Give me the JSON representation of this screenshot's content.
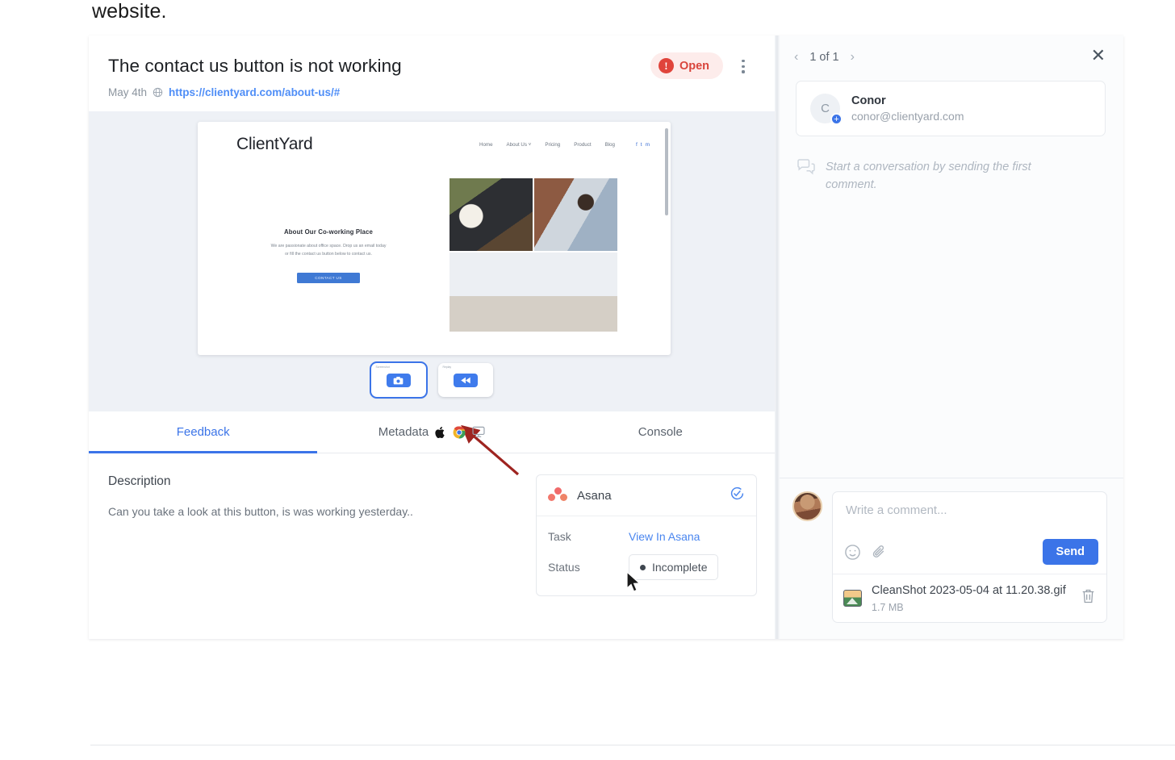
{
  "stray_text": "website.",
  "header": {
    "title": "The contact us button is not working",
    "status_label": "Open",
    "status_color": "#d9453c",
    "date": "May 4th",
    "url": "https://clientyard.com/about-us/#",
    "menu_icon": "kebab-menu-icon"
  },
  "preview": {
    "site": {
      "logo": "ClientYard",
      "nav": [
        "Home",
        "About Us ˅",
        "Pricing",
        "Product",
        "Blog"
      ],
      "social": [
        "f",
        "t",
        "m"
      ],
      "heading": "About Our Co-working Place",
      "paragraph_1": "We are passionate about office space. Drop us an email today",
      "paragraph_2": "or fill the contact us button below to contact us.",
      "button_label": "CONTACT US"
    },
    "thumbnails": [
      {
        "caption": "Screenshot",
        "icon": "camera-icon",
        "selected": true
      },
      {
        "caption": "Replay",
        "icon": "rewind-icon",
        "selected": false
      }
    ]
  },
  "tabs": [
    {
      "label": "Feedback",
      "active": true
    },
    {
      "label": "Metadata",
      "active": false,
      "icons": [
        "apple-icon",
        "chrome-icon",
        "desktop-icon"
      ]
    },
    {
      "label": "Console",
      "active": false
    }
  ],
  "feedback": {
    "description_heading": "Description",
    "description_text": "Can you take a look at this button, is was working yesterday..",
    "integration": {
      "name": "Asana",
      "sync_icon": "sync-check-icon",
      "rows": [
        {
          "key": "Task",
          "value": "View In Asana",
          "type": "link"
        },
        {
          "key": "Status",
          "value": "Incomplete",
          "type": "chip"
        }
      ]
    }
  },
  "right_panel": {
    "nav": {
      "prev": "‹",
      "counter": "1 of 1",
      "next": "›"
    },
    "close_icon": "close-icon",
    "user": {
      "initial": "C",
      "name": "Conor",
      "email": "conor@clientyard.com",
      "badge_icon": "add-user-icon"
    },
    "empty_state": {
      "icon": "chat-bubble-icon",
      "text": "Start a conversation by sending the first comment."
    },
    "composer": {
      "placeholder": "Write a comment...",
      "emoji_icon": "emoji-icon",
      "attach_icon": "paperclip-icon",
      "send_label": "Send",
      "attachment": {
        "name": "CleanShot 2023-05-04 at 11.20.38.gif",
        "size": "1.7 MB",
        "delete_icon": "trash-icon"
      }
    }
  }
}
